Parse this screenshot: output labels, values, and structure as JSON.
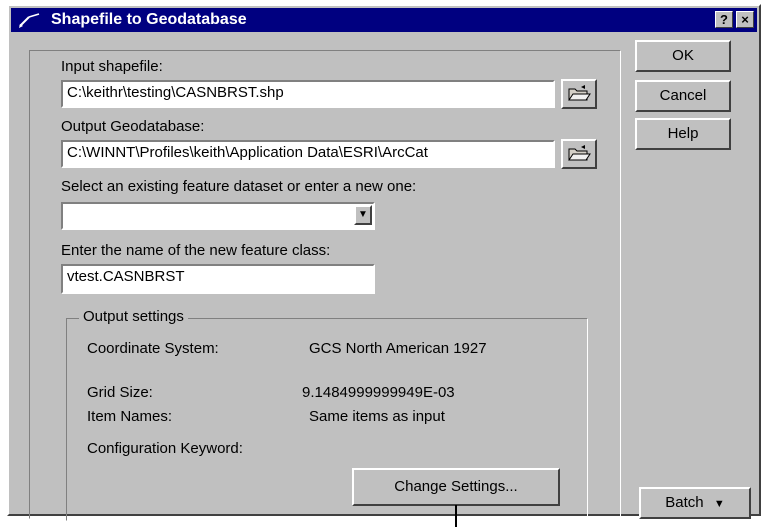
{
  "window": {
    "title": "Shapefile to Geodatabase",
    "help_glyph": "?",
    "close_glyph": "×"
  },
  "form": {
    "input_shapefile_label": "Input shapefile:",
    "input_shapefile_value": "C:\\keithr\\testing\\CASNBRST.shp",
    "output_geodatabase_label": "Output Geodatabase:",
    "output_geodatabase_value": "C:\\WINNT\\Profiles\\keith\\Application Data\\ESRI\\ArcCat",
    "dataset_label": "Select an existing feature dataset or enter a new one:",
    "dataset_value": "",
    "feature_class_label": "Enter the name of the new feature class:",
    "feature_class_value": "vtest.CASNBRST"
  },
  "output_settings": {
    "group_title": "Output settings",
    "coordinate_system_label": "Coordinate System:",
    "coordinate_system_value": "GCS North American 1927",
    "grid_size_label": "Grid Size:",
    "grid_size_value": "9.1484999999949E-03",
    "item_names_label": "Item Names:",
    "item_names_value": "Same items as input",
    "config_keyword_label": "Configuration Keyword:",
    "config_keyword_value": "",
    "change_settings_label": "Change Settings..."
  },
  "buttons": {
    "ok": "OK",
    "cancel": "Cancel",
    "help": "Help",
    "batch": "Batch",
    "batch_arrow": "▼",
    "dropdown_arrow": "▼"
  },
  "icons": {
    "window_icon": "pencil-icon",
    "browse_icon": "open-folder-icon"
  }
}
